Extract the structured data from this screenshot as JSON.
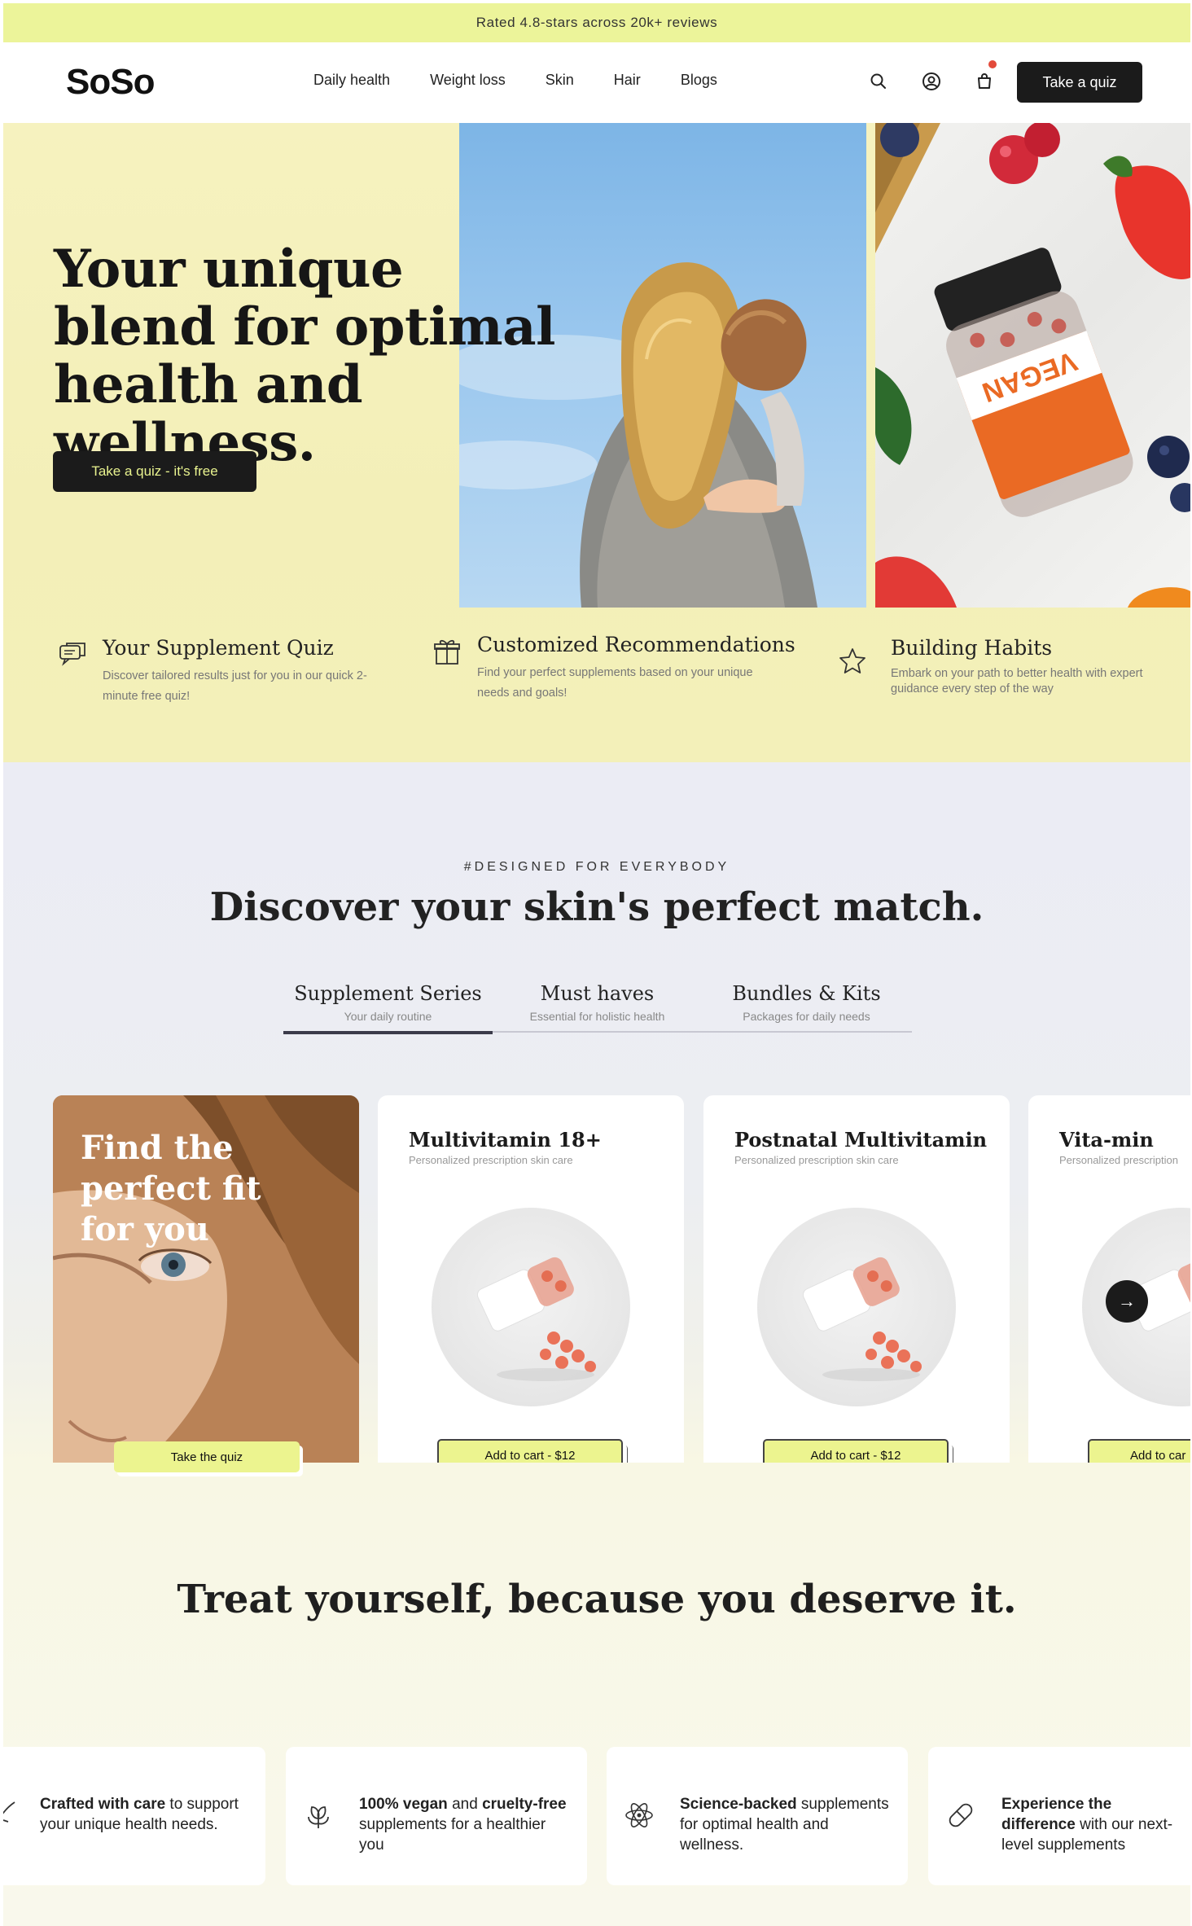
{
  "announcement": {
    "text": "Rated 4.8-stars across 20k+ reviews"
  },
  "header": {
    "logo": "SoSo",
    "nav": [
      "Daily health",
      "Weight loss",
      "Skin",
      "Hair",
      "Blogs"
    ],
    "cta": "Take a quiz",
    "icons": [
      "search-icon",
      "account-icon",
      "cart-icon"
    ],
    "cart_has_notification": true
  },
  "hero": {
    "title": "Your unique blend for optimal health and wellness.",
    "cta": "Take a quiz - it's free",
    "bottle_label": "VEGAN",
    "features": [
      {
        "icon": "chat-bubbles-icon",
        "title": "Your Supplement Quiz",
        "desc": "Discover tailored results just for you in our quick 2-minute free quiz!"
      },
      {
        "icon": "gift-icon",
        "title": "Customized Recommendations",
        "desc": "Find your perfect supplements based on your unique needs and goals!"
      },
      {
        "icon": "star-icon",
        "title": "Building Habits",
        "desc": "Embark on your path to better health with expert guidance every step of the way"
      }
    ]
  },
  "products_section": {
    "tag": "#DESIGNED FOR EVERYBODY",
    "title": "Discover your skin's perfect match.",
    "tabs": [
      {
        "label": "Supplement Series",
        "sub": "Your daily routine",
        "active": true
      },
      {
        "label": "Must haves",
        "sub": "Essential for holistic health",
        "active": false
      },
      {
        "label": "Bundles & Kits",
        "sub": "Packages for daily needs",
        "active": false
      }
    ],
    "promo": {
      "title": "Find the perfect fit for you",
      "cta": "Take the quiz"
    },
    "products": [
      {
        "name": "Multivitamin 18+",
        "sub": "Personalized prescription skin care",
        "cta": "Add to cart - $12"
      },
      {
        "name": "Postnatal Multivitamin",
        "sub": "Personalized prescription skin care",
        "cta": "Add to cart - $12"
      },
      {
        "name": "Vita-min",
        "sub": "Personalized prescription",
        "cta": "Add to car"
      }
    ],
    "next_arrow": "→"
  },
  "benefits_section": {
    "title": "Treat yourself, because you deserve it.",
    "items": [
      {
        "icon": "feather-icon",
        "bold": "Crafted with care",
        "rest": " to support your unique health needs.",
        "bold2": "",
        "rest2": ""
      },
      {
        "icon": "leaf-icon",
        "bold": "100% vegan",
        "rest": " and ",
        "bold2": "cruelty-free",
        "rest2": " supplements for a healthier you"
      },
      {
        "icon": "atom-icon",
        "bold": "Science-backed",
        "rest": " supplements for optimal health and wellness.",
        "bold2": "",
        "rest2": ""
      },
      {
        "icon": "capsule-icon",
        "bold": "Experience the difference",
        "rest": " with our next-level supplements",
        "bold2": "",
        "rest2": ""
      }
    ]
  },
  "colors": {
    "accent_yellow": "#ecf48f",
    "dark": "#1b1b1b",
    "hero_bg": "#f6f2bf",
    "products_bg": "#ebecf4",
    "notification": "#e34a3a"
  }
}
